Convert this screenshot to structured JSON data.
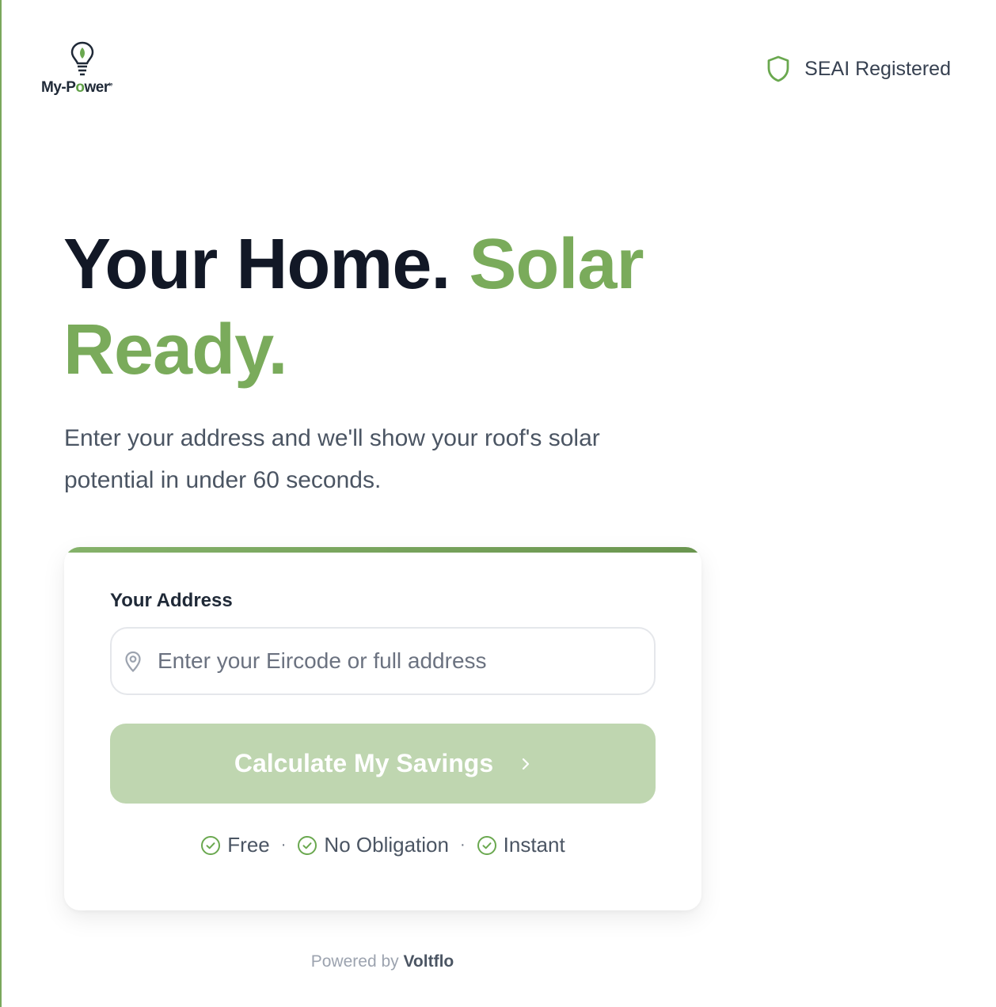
{
  "brand": {
    "logo_text_prefix": "My-P",
    "logo_text_o": "o",
    "logo_text_suffix": "wer",
    "logo_mark": "ie",
    "accent_color": "#7aab5b"
  },
  "header": {
    "badge_text": "SEAI Registered",
    "badge_icon": "shield-icon"
  },
  "hero": {
    "title_part1": "Your Home.",
    "title_part2": "Solar Ready.",
    "subtitle": "Enter your address and we'll show your roof's solar potential in under 60 seconds."
  },
  "form": {
    "address_label": "Your Address",
    "address_value": "",
    "address_placeholder": "Enter your Eircode or full address",
    "address_icon": "map-pin-icon",
    "submit_label": "Calculate My Savings",
    "submit_icon": "chevron-right-icon",
    "submit_color": "#bfd6b0"
  },
  "benefits": [
    {
      "label": "Free",
      "icon": "check-circle-icon"
    },
    {
      "label": "No Obligation",
      "icon": "check-circle-icon"
    },
    {
      "label": "Instant",
      "icon": "check-circle-icon"
    }
  ],
  "benefit_separator": "·",
  "footer": {
    "powered_prefix": "Powered by",
    "powered_brand": "Voltflo"
  }
}
